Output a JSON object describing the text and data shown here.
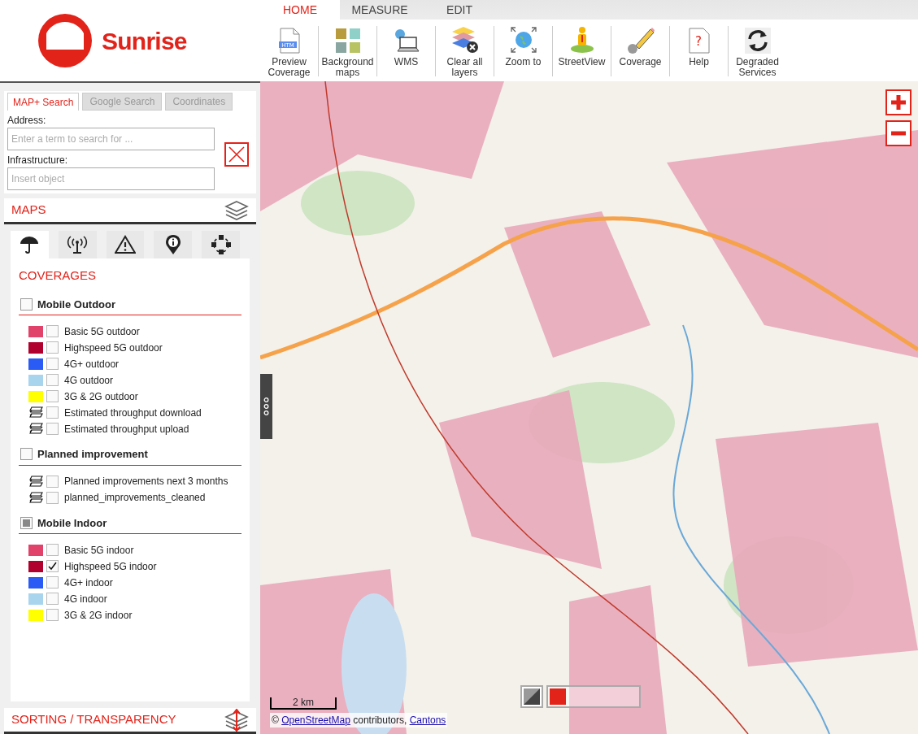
{
  "logo": {
    "text": "Sunrise"
  },
  "menu_tabs": [
    {
      "label": "HOME",
      "selected": true
    },
    {
      "label": "MEASURE",
      "selected": false
    },
    {
      "label": "EDIT",
      "selected": false
    }
  ],
  "toolbar": [
    {
      "label": "Preview Coverage",
      "icon_text": "HTM"
    },
    {
      "label": "Background maps"
    },
    {
      "label": "WMS"
    },
    {
      "label": "Clear all layers"
    },
    {
      "label": "Zoom to"
    },
    {
      "label": "StreetView"
    },
    {
      "label": "Coverage"
    },
    {
      "label": "Help",
      "icon_text": "?"
    },
    {
      "label": "Degraded Services"
    }
  ],
  "search": {
    "tabs": [
      {
        "label": "MAP+ Search",
        "selected": true
      },
      {
        "label": "Google Search",
        "selected": false
      },
      {
        "label": "Coordinates",
        "selected": false
      }
    ],
    "fields": [
      {
        "label": "Address:",
        "placeholder": "Enter a term to search for ..."
      },
      {
        "label": "Infrastructure:",
        "placeholder": "Insert object"
      }
    ]
  },
  "maps_panel": {
    "title": "MAPS",
    "category_tabs": [
      {
        "selected": true
      },
      {
        "selected": false
      },
      {
        "selected": false
      },
      {
        "selected": false
      },
      {
        "selected": false
      }
    ],
    "coverages": {
      "title": "COVERAGES",
      "groups": [
        {
          "label": "Mobile Outdoor",
          "checked": false,
          "partial": false,
          "items": [
            {
              "kind": "swatch",
              "color": "#e0426a",
              "label": "Basic 5G outdoor",
              "checked": false
            },
            {
              "kind": "swatch",
              "color": "#b0002e",
              "label": "Highspeed 5G outdoor",
              "checked": false
            },
            {
              "kind": "swatch",
              "color": "#2a5cf5",
              "label": "4G+ outdoor",
              "checked": false
            },
            {
              "kind": "swatch",
              "color": "#a8d4ee",
              "label": "4G outdoor",
              "checked": false
            },
            {
              "kind": "swatch",
              "color": "#ffff00",
              "label": "3G & 2G outdoor",
              "checked": false
            },
            {
              "kind": "layers",
              "label": "Estimated throughput download",
              "checked": false
            },
            {
              "kind": "layers",
              "label": "Estimated throughput upload",
              "checked": false
            }
          ]
        },
        {
          "label": "Planned improvement",
          "checked": false,
          "partial": false,
          "items": [
            {
              "kind": "layers",
              "label": "Planned improvements next 3 months",
              "checked": false
            },
            {
              "kind": "layers",
              "label": "planned_improvements_cleaned",
              "checked": false
            }
          ]
        },
        {
          "label": "Mobile Indoor",
          "checked": false,
          "partial": true,
          "items": [
            {
              "kind": "swatch",
              "color": "#e0426a",
              "label": "Basic 5G indoor",
              "checked": false
            },
            {
              "kind": "swatch",
              "color": "#b0002e",
              "label": "Highspeed 5G indoor",
              "checked": true
            },
            {
              "kind": "swatch",
              "color": "#2a5cf5",
              "label": "4G+ indoor",
              "checked": false
            },
            {
              "kind": "swatch",
              "color": "#a8d4ee",
              "label": "4G indoor",
              "checked": false
            },
            {
              "kind": "swatch",
              "color": "#ffff00",
              "label": "3G & 2G indoor",
              "checked": false
            }
          ]
        }
      ]
    }
  },
  "sorting_panel": {
    "title": "SORTING / TRANSPARENCY"
  },
  "map": {
    "scale": "2 km",
    "attribution": [
      {
        "kind": "text",
        "text": "©"
      },
      {
        "kind": "link",
        "text": "OpenStreetMap"
      },
      {
        "kind": "text",
        "text": "contributors,"
      },
      {
        "kind": "link",
        "text": "Cantons"
      }
    ],
    "basemaps": [
      {
        "selected": false
      },
      {
        "selected": true
      }
    ]
  }
}
